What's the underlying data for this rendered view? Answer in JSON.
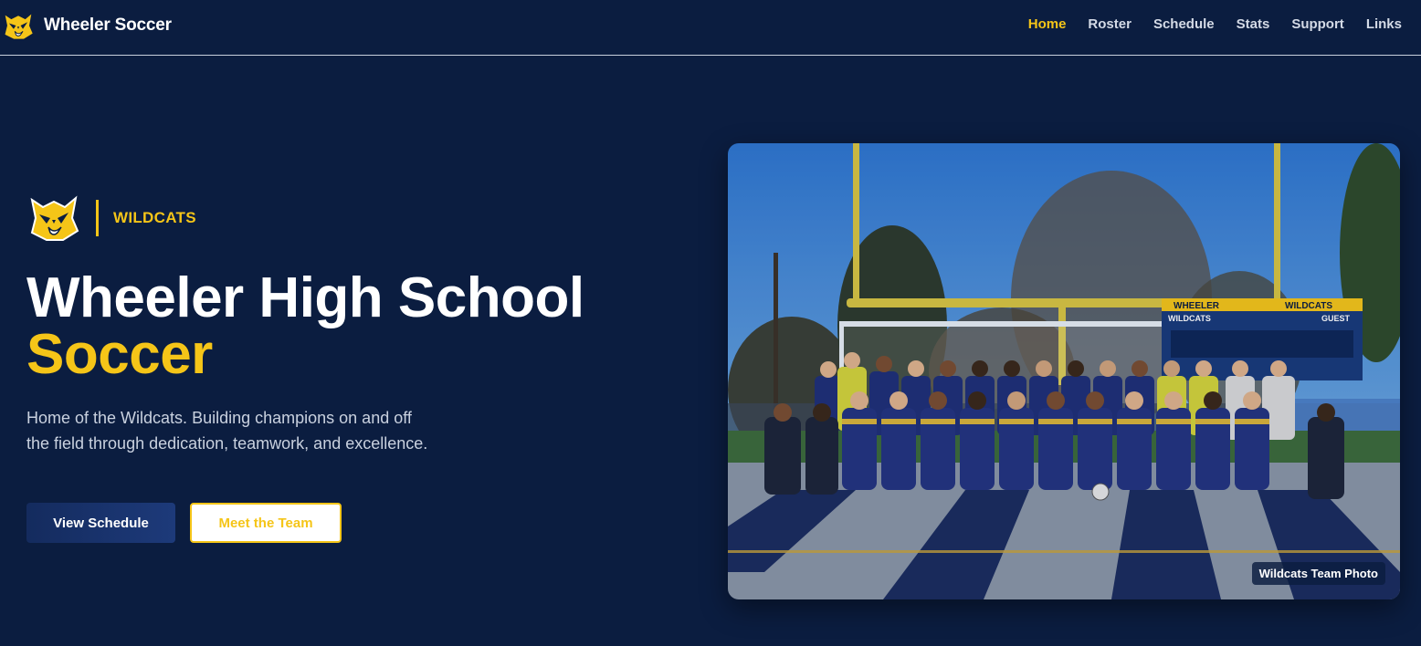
{
  "nav": {
    "brand": "Wheeler Soccer",
    "links": [
      {
        "label": "Home",
        "active": true
      },
      {
        "label": "Roster",
        "active": false
      },
      {
        "label": "Schedule",
        "active": false
      },
      {
        "label": "Stats",
        "active": false
      },
      {
        "label": "Support",
        "active": false
      },
      {
        "label": "Links",
        "active": false
      }
    ]
  },
  "hero": {
    "badge": "WILDCATS",
    "title_line1": "Wheeler High School",
    "title_line2": "Soccer",
    "description": "Home of the Wildcats. Building champions on and off the field through dedication, teamwork, and excellence.",
    "primary_button": "View Schedule",
    "secondary_button": "Meet the Team",
    "photo_caption": "Wildcats Team Photo",
    "scoreboard": {
      "title_left": "WHEELER",
      "title_right": "WILDCATS",
      "home": "WILDCATS",
      "guest": "GUEST"
    }
  },
  "colors": {
    "background": "#0b1d40",
    "accent_gold": "#f5c518",
    "nav_text": "#d4dae6",
    "body_text": "#c9d1df"
  },
  "icons": {
    "brand_logo": "wildcat-mascot-icon",
    "badge_logo": "wildcat-mascot-icon"
  }
}
